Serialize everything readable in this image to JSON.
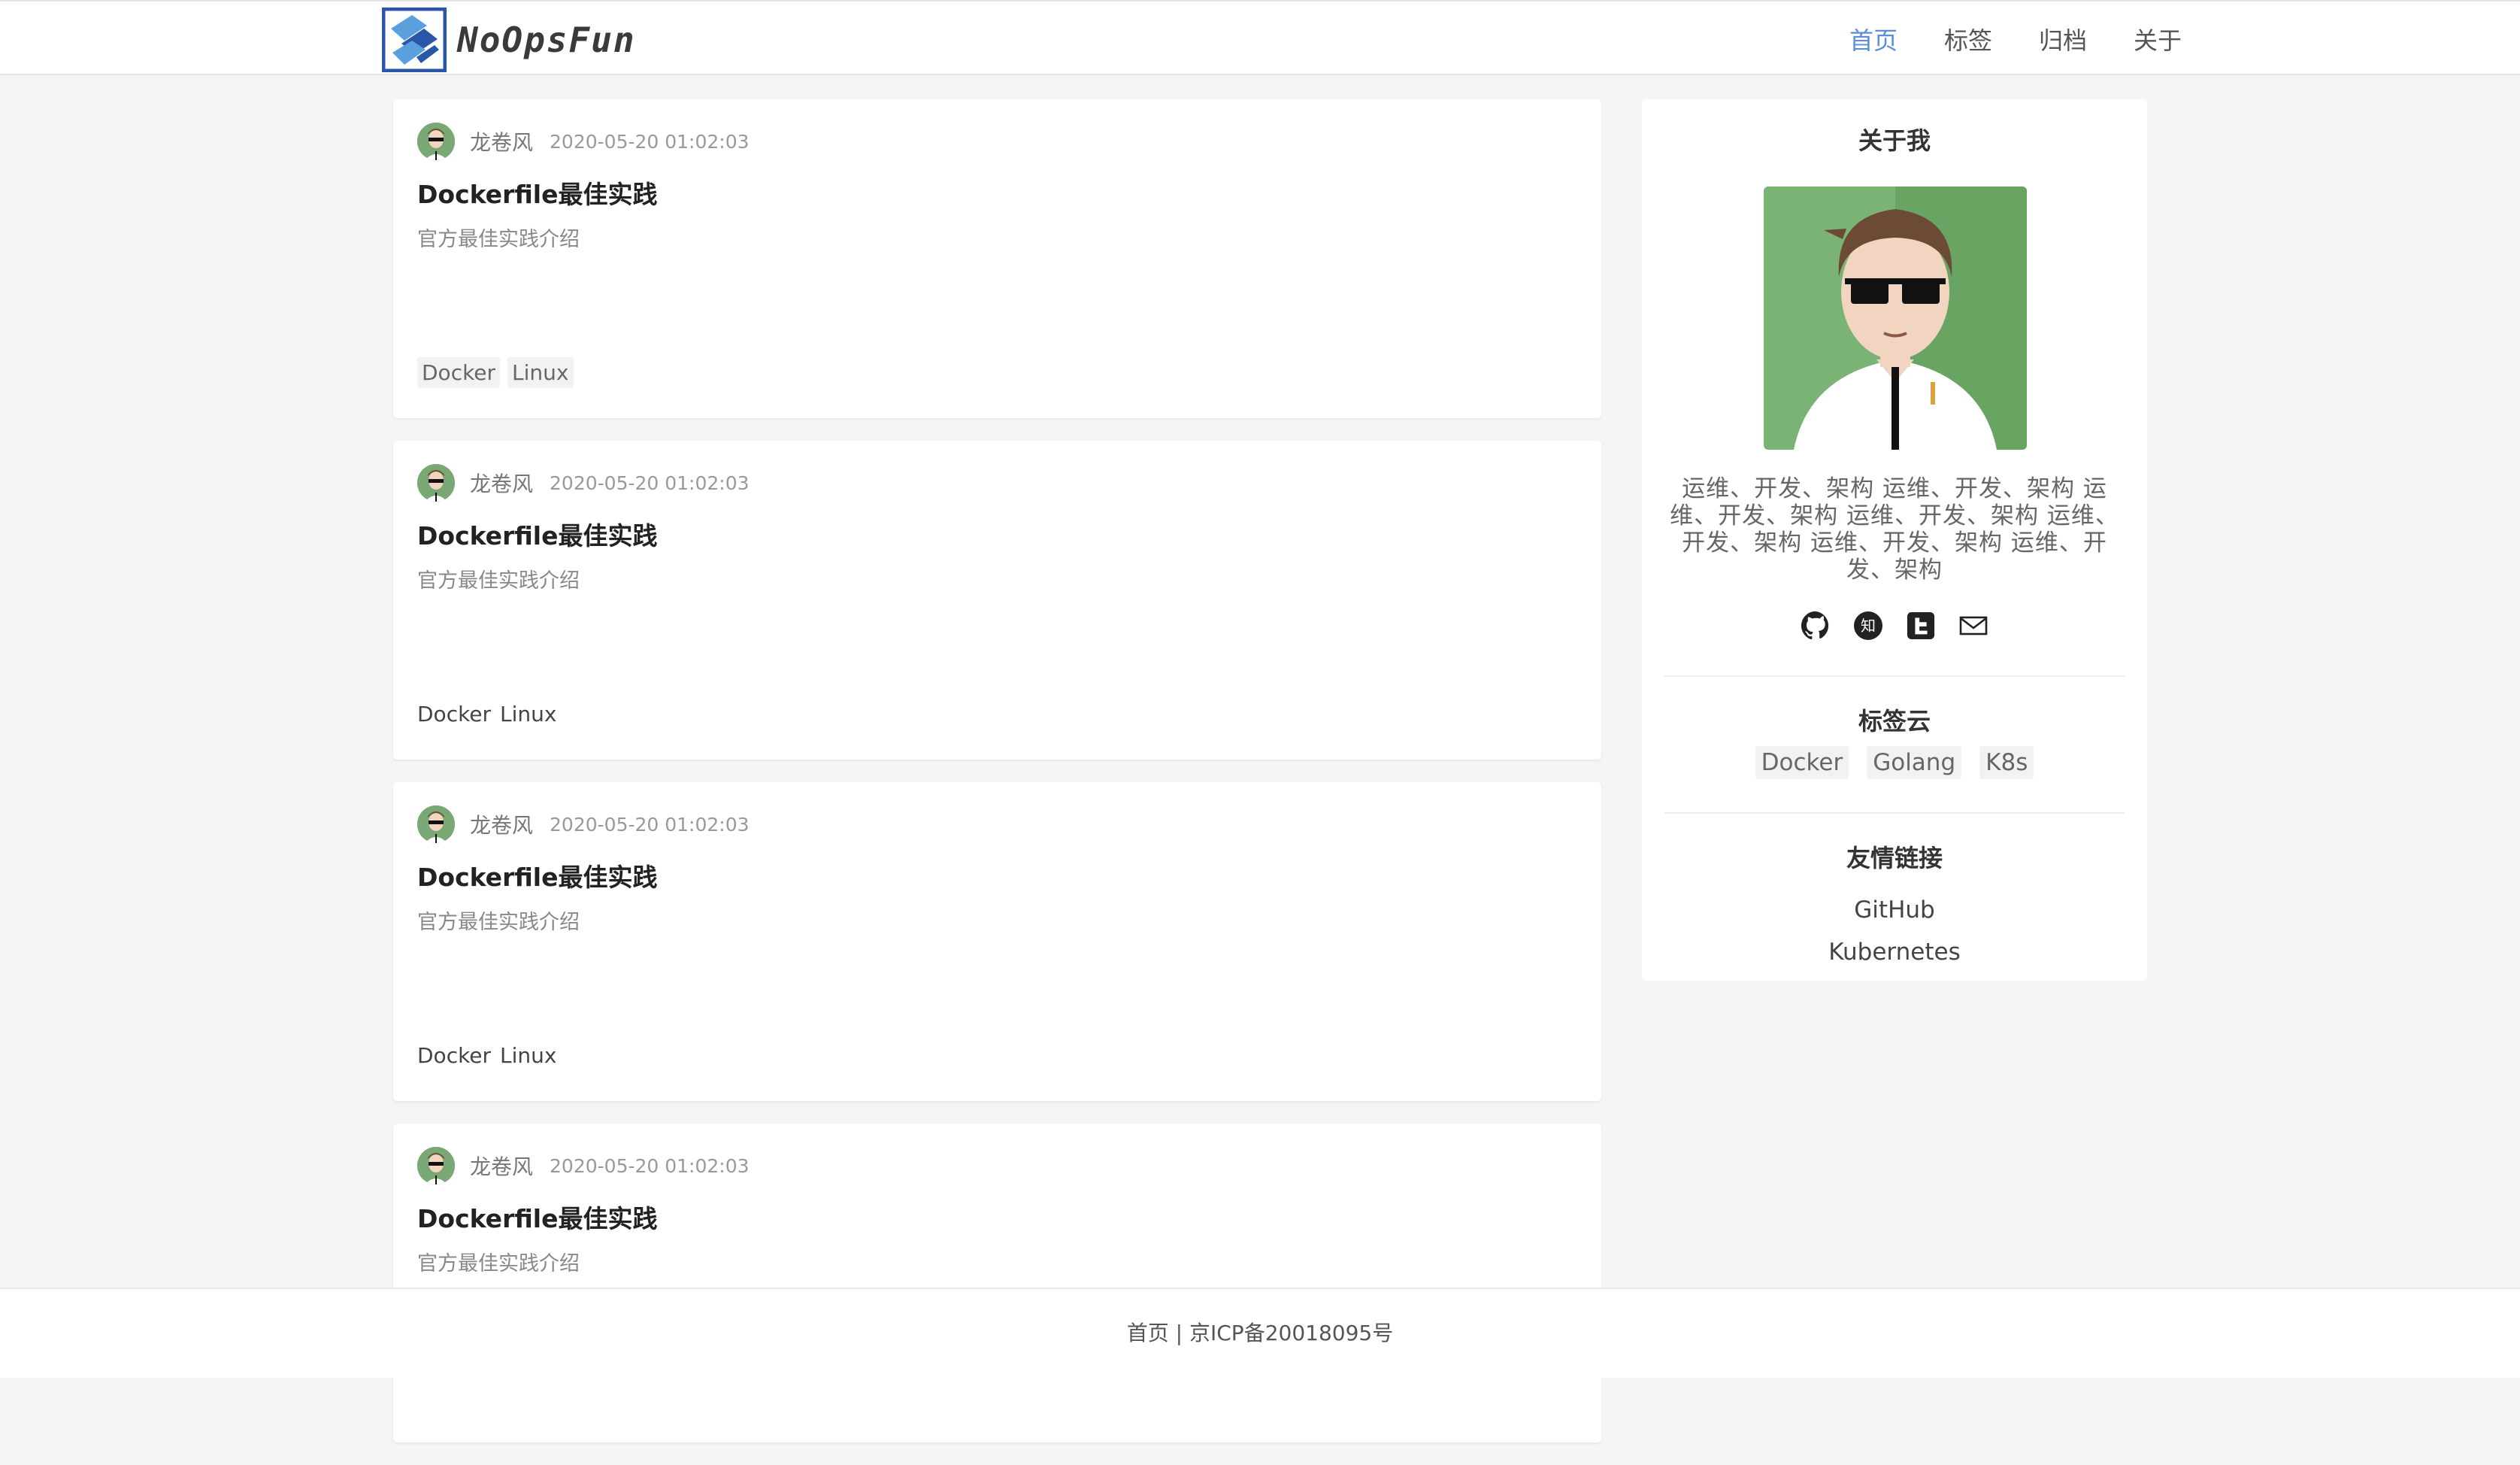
{
  "header": {
    "logo_text": "NoOpsFun",
    "nav": [
      "首页",
      "标签",
      "归档",
      "关于"
    ],
    "active_index": 0
  },
  "posts": [
    {
      "author": "龙卷风",
      "date": "2020-05-20 01:02:03",
      "title": "Dockerfile最佳实践",
      "summary": "官方最佳实践介绍",
      "tags": [
        "Docker",
        "Linux"
      ]
    },
    {
      "author": "龙卷风",
      "date": "2020-05-20 01:02:03",
      "title": "Dockerfile最佳实践",
      "summary": "官方最佳实践介绍",
      "tags": [
        "Docker",
        "Linux"
      ]
    },
    {
      "author": "龙卷风",
      "date": "2020-05-20 01:02:03",
      "title": "Dockerfile最佳实践",
      "summary": "官方最佳实践介绍",
      "tags": [
        "Docker",
        "Linux"
      ]
    },
    {
      "author": "龙卷风",
      "date": "2020-05-20 01:02:03",
      "title": "Dockerfile最佳实践",
      "summary": "官方最佳实践介绍",
      "tags": []
    }
  ],
  "sidebar": {
    "about_title": "关于我",
    "bio": "运维、开发、架构 运维、开发、架构 运维、开发、架构 运维、开发、架构 运维、开发、架构 运维、开发、架构 运维、开发、架构",
    "social_icons": [
      "github-icon",
      "zhihu-icon",
      "toutiao-icon",
      "mail-icon"
    ],
    "zhihu_glyph": "知",
    "tagcloud_title": "标签云",
    "tagcloud": [
      "Docker",
      "Golang",
      "K8s"
    ],
    "links_title": "友情链接",
    "links": [
      "GitHub",
      "Kubernetes"
    ]
  },
  "footer": {
    "text": "首页 | 京ICP备20018095号"
  },
  "colors": {
    "accent": "#5b8ed8",
    "background": "#f4f5f7",
    "avatar_green": "#7aa874"
  }
}
